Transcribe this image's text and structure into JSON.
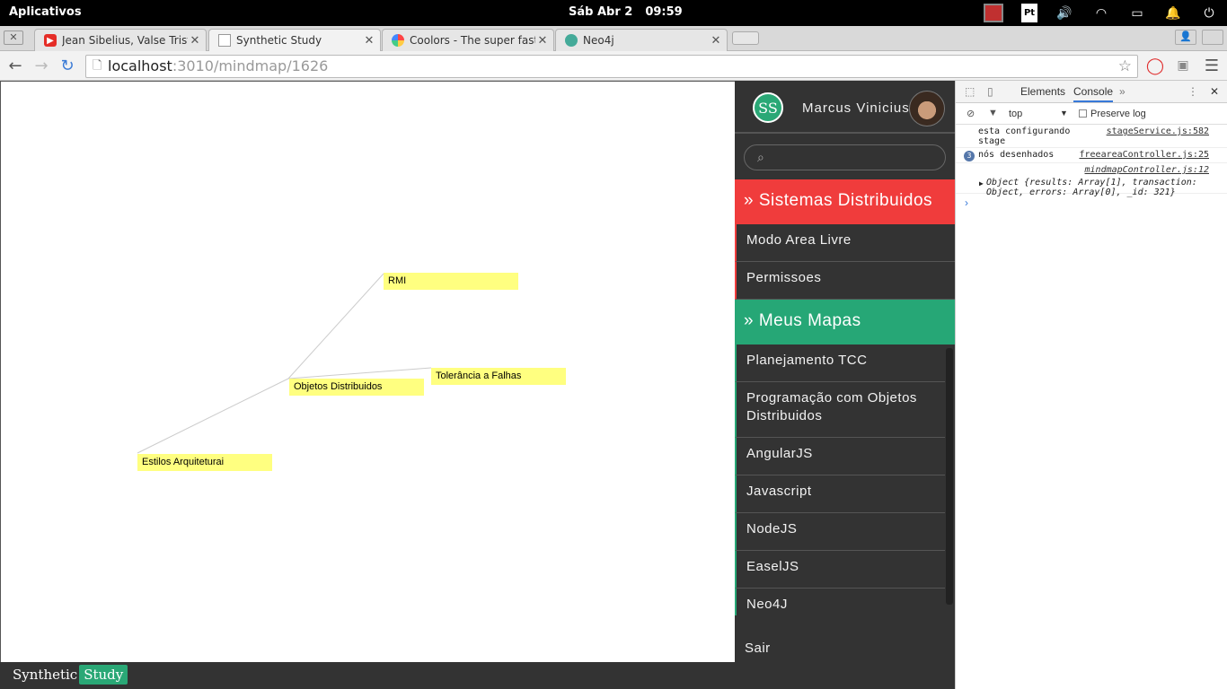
{
  "os_bar": {
    "app_menu": "Aplicativos",
    "date": "Sáb Abr  2",
    "time": "09:59"
  },
  "tabs": [
    {
      "title": "Jean Sibelius, Valse Triste",
      "icon": "youtube-icon"
    },
    {
      "title": "Synthetic Study",
      "icon": "page-icon"
    },
    {
      "title": "Coolors - The super fast color",
      "icon": "coolors-icon"
    },
    {
      "title": "Neo4j",
      "icon": "neo4j-icon"
    }
  ],
  "address_bar": {
    "host": "localhost",
    "path": ":3010/mindmap/1626"
  },
  "mindmap": {
    "nodes": [
      {
        "label": "RMI"
      },
      {
        "label": "Tolerância a Falhas"
      },
      {
        "label": "Objetos Distribuidos"
      },
      {
        "label": "Estilos Arquiteturai"
      }
    ]
  },
  "sidebar": {
    "logo": "SS",
    "user_name": "Marcus Vinicius",
    "search_placeholder": "",
    "current_map_section": "» Sistemas Distribuidos",
    "current_map_items": [
      {
        "label": "Modo Area Livre"
      },
      {
        "label": "Permissoes"
      }
    ],
    "my_maps_section": "» Meus Mapas",
    "my_maps": [
      {
        "label": "Planejamento TCC"
      },
      {
        "label": "Programação com Objetos Distribuidos"
      },
      {
        "label": "AngularJS"
      },
      {
        "label": "Javascript"
      },
      {
        "label": "NodeJS"
      },
      {
        "label": "EaselJS"
      },
      {
        "label": "Neo4J"
      }
    ],
    "logout": "Sair"
  },
  "footer": {
    "brand_part1": "Synthetic",
    "brand_part2": "Study"
  },
  "devtools": {
    "tab_elements": "Elements",
    "tab_console": "Console",
    "context": "top",
    "preserve_log": "Preserve log",
    "logs": [
      {
        "text": "esta configurando stage",
        "source": "stageService.js:582"
      },
      {
        "count": "3",
        "text": "nós desenhados",
        "source": "freeareaController.js:25"
      },
      {
        "text": "",
        "source": "mindmapController.js:12"
      }
    ],
    "object_line1": "Object {results: Array[1], transaction:",
    "object_line2": "Object, errors: Array[0], _id: 321}"
  },
  "colors": {
    "accent_green": "#26a776",
    "accent_red": "#f03c3c",
    "node_yellow": "#ffff80"
  }
}
